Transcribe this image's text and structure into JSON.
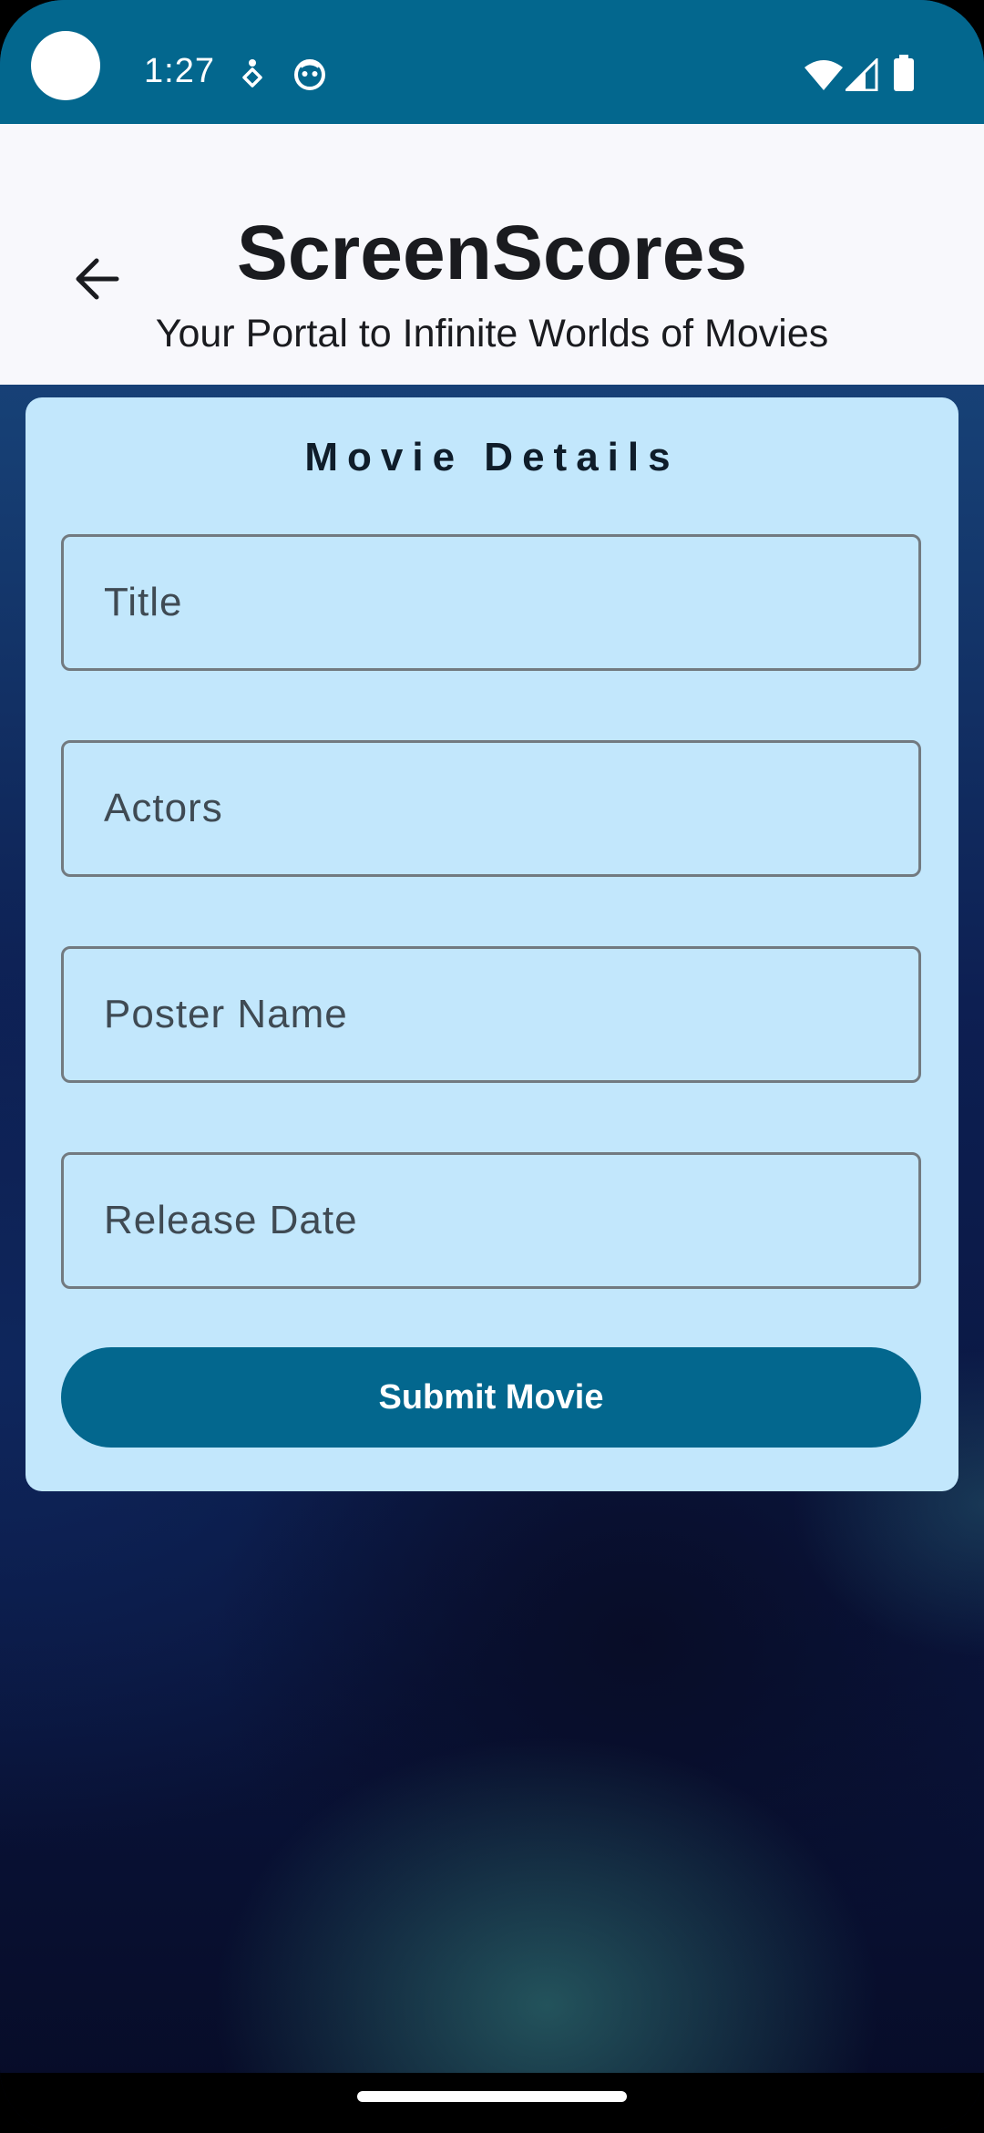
{
  "status_bar": {
    "time": "1:27",
    "icons": [
      "accessibility-icon",
      "face-icon",
      "wifi-icon",
      "signal-icon",
      "battery-icon"
    ],
    "background": "#03678e"
  },
  "header": {
    "title": "ScreenScores",
    "subtitle": "Your Portal to Infinite Worlds of Movies",
    "back_icon": "arrow-back-icon"
  },
  "form": {
    "title": "Movie Details",
    "fields": [
      {
        "placeholder": "Title",
        "value": ""
      },
      {
        "placeholder": "Actors",
        "value": ""
      },
      {
        "placeholder": "Poster Name",
        "value": ""
      },
      {
        "placeholder": "Release Date",
        "value": ""
      }
    ],
    "submit_label": "Submit Movie",
    "card_color": "#c2e7fc",
    "button_color": "#03678e"
  }
}
